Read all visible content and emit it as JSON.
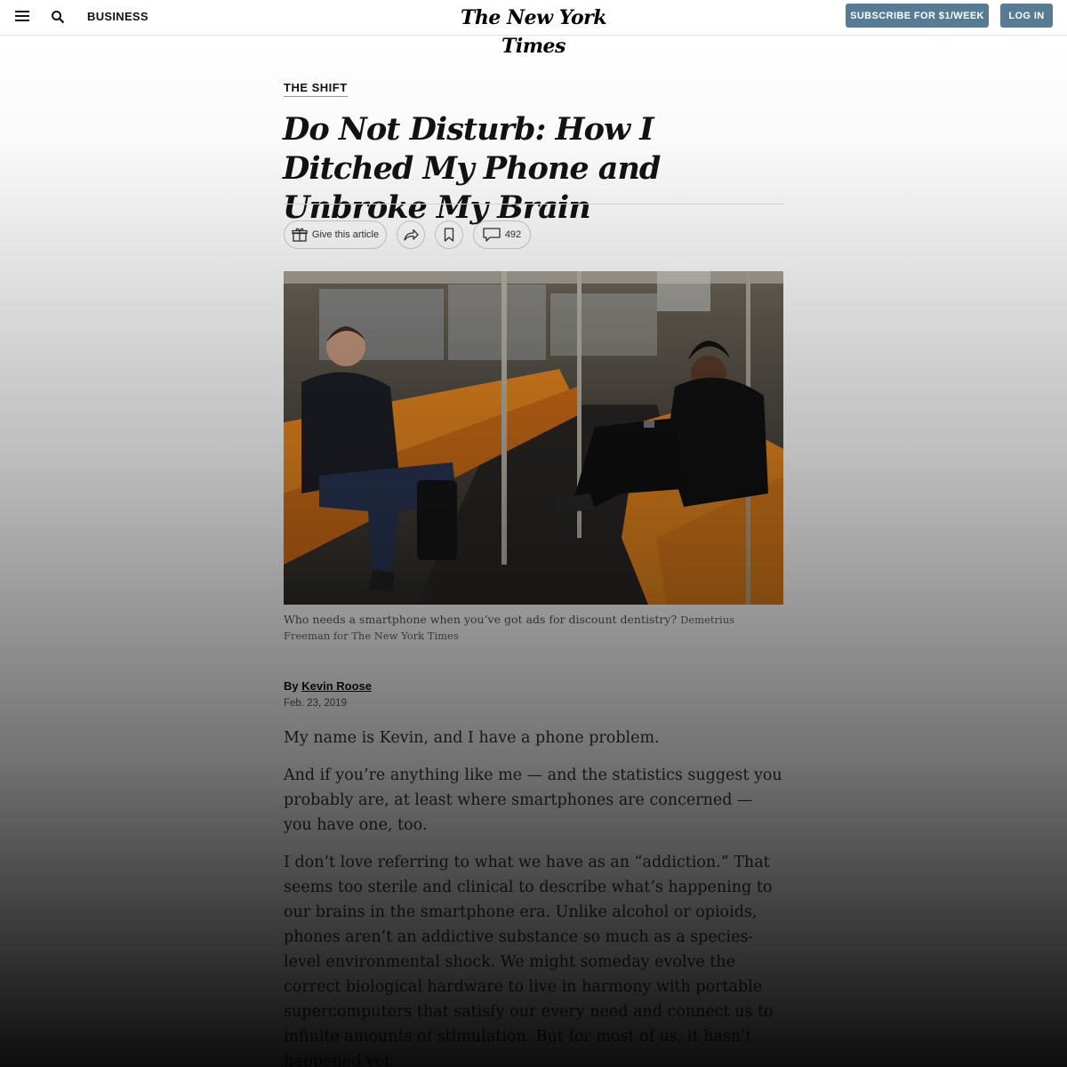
{
  "header": {
    "section": "BUSINESS",
    "logo": "The New York Times",
    "subscribe_label": "SUBSCRIBE FOR $1/WEEK",
    "login_label": "LOG IN"
  },
  "article": {
    "kicker": "THE SHIFT",
    "headline": "Do Not Disturb: How I Ditched My Phone and Unbroke My Brain",
    "tools": {
      "gift_label": "Give this article",
      "comment_count": "492"
    },
    "caption": "Who needs a smartphone when you’ve got ads for discount dentistry?",
    "credit": "Demetrius Freeman for The New York Times",
    "byline_prefix": "By",
    "author": "Kevin Roose",
    "date": "Feb. 23, 2019",
    "paragraphs": [
      "My name is Kevin, and I have a phone problem.",
      "And if you’re anything like me — and the statistics suggest you probably are, at least where smartphones are concerned — you have one, too.",
      "I don’t love referring to what we have as an “addiction.” That seems too sterile and clinical to describe what’s happening to our brains in the smartphone era. Unlike alcohol or opioids, phones aren’t an addictive substance so much as a species-level environmental shock. We might someday evolve the correct biological hardware to live in harmony with portable supercomputers that satisfy our every need and connect us to infinite amounts of stimulation. But for most of us, it hasn’t happened yet."
    ]
  },
  "colors": {
    "button_bg": "#567b95",
    "seat_orange": "#e8871e"
  }
}
